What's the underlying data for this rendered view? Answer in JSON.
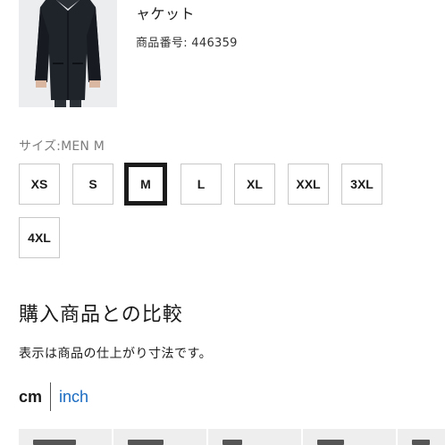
{
  "product": {
    "title": "ャケット",
    "code": "商品番号: 446359",
    "image_icon": "jacket-icon"
  },
  "size_selector": {
    "label": "サイズ:MEN M",
    "selected": "M",
    "options": [
      "XS",
      "S",
      "M",
      "L",
      "XL",
      "XXL",
      "3XL",
      "4XL"
    ]
  },
  "compare": {
    "heading": "購入商品との比較",
    "note": "表示は商品の仕上がり寸法です。"
  },
  "units": {
    "cm": "cm",
    "inch": "inch",
    "selected": "cm"
  },
  "colors": {
    "accent_link": "#1a6bc2",
    "text": "#1b1b1b",
    "muted": "#7d7d7d",
    "border": "#c8c8c8",
    "thumb_bg": "#ecedef"
  }
}
